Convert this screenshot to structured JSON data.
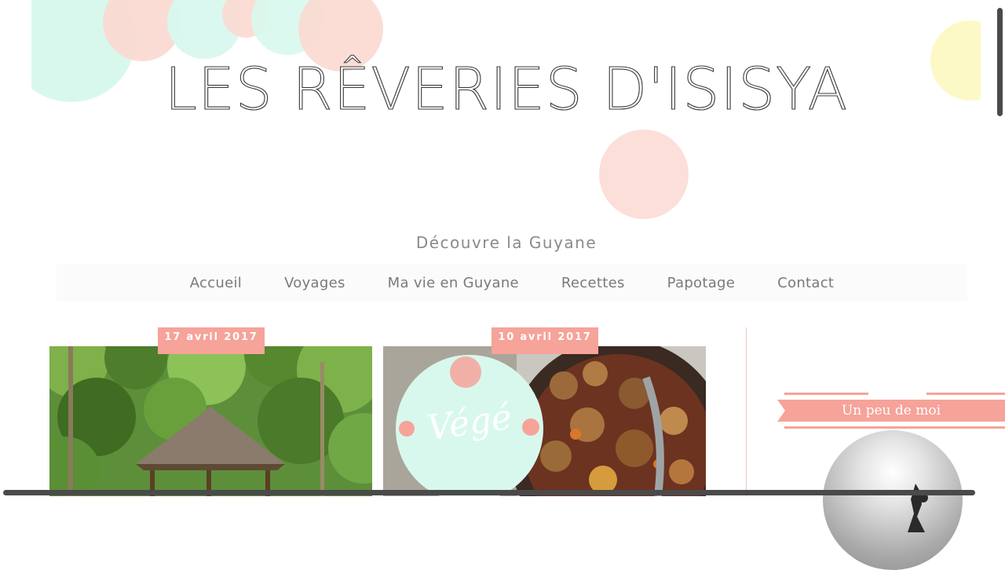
{
  "header": {
    "title": "LES RÊVERIES D'ISISYA",
    "tagline": "Découvre la Guyane"
  },
  "nav": {
    "items": [
      "Accueil",
      "Voyages",
      "Ma vie en Guyane",
      "Recettes",
      "Papotage",
      "Contact"
    ]
  },
  "posts": [
    {
      "date": "17 avril 2017"
    },
    {
      "date": "10 avril 2017",
      "badge": "Végé"
    }
  ],
  "sidebar": {
    "widget_title": "Un peu de moi"
  },
  "colors": {
    "accent": "#f6a39a",
    "mint": "#d8f8ee",
    "peach": "#fbd9d1",
    "yellow": "#fdf9c6"
  }
}
